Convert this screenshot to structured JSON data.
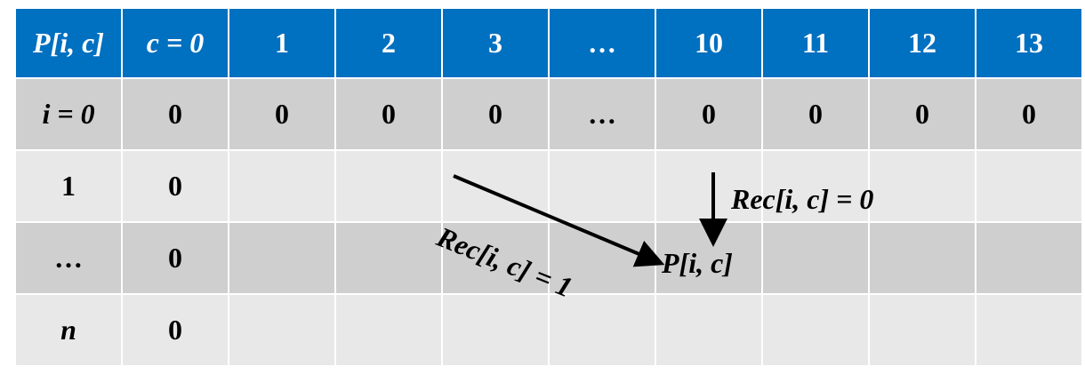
{
  "table": {
    "corner": "P[i, c]",
    "columns": [
      "c = 0",
      "1",
      "2",
      "3",
      "…",
      "10",
      "11",
      "12",
      "13"
    ],
    "rows": [
      {
        "label": "i = 0",
        "cells": [
          "0",
          "0",
          "0",
          "0",
          "…",
          "0",
          "0",
          "0",
          "0"
        ]
      },
      {
        "label": "1",
        "cells": [
          "0",
          "",
          "",
          "",
          "",
          "",
          "",
          "",
          ""
        ]
      },
      {
        "label": "…",
        "cells": [
          "0",
          "",
          "",
          "",
          "",
          "",
          "",
          "",
          ""
        ]
      },
      {
        "label": "n",
        "cells": [
          "0",
          "",
          "",
          "",
          "",
          "",
          "",
          "",
          ""
        ]
      }
    ]
  },
  "annotations": {
    "diag_label": "Rec[i, c] = 1",
    "down_label": "Rec[i, c] = 0",
    "target_label": "P[i, c]"
  },
  "colors": {
    "header_bg": "#0070c0",
    "header_text": "#ffffff",
    "row_dark": "#cfcfcf",
    "row_light": "#e8e8e8",
    "arrow": "#000000"
  }
}
